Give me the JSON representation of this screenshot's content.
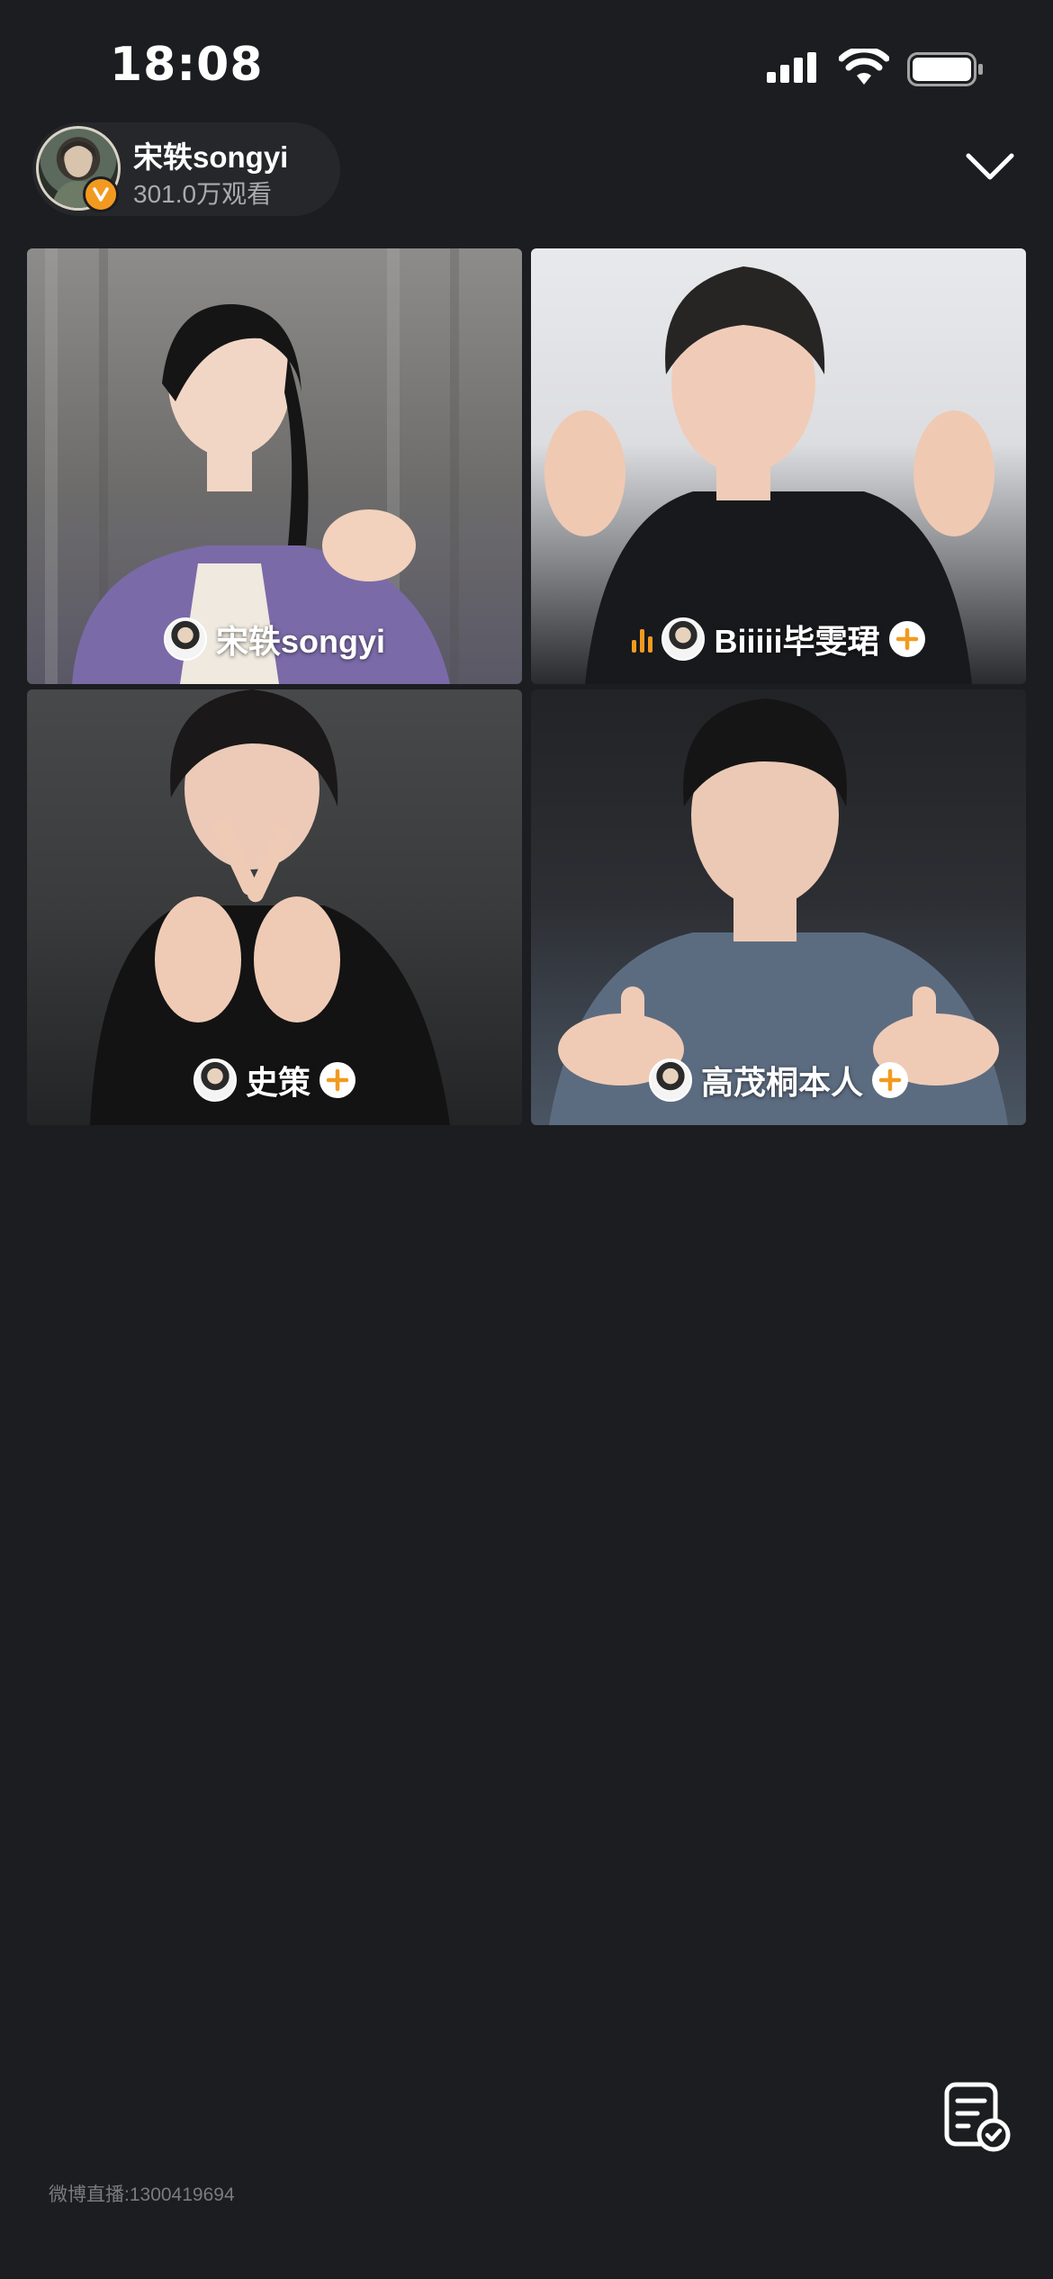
{
  "status_bar": {
    "time": "18:08"
  },
  "header": {
    "host_name": "宋轶songyi",
    "viewer_count": "301.0万观看"
  },
  "tiles": [
    {
      "name": "宋轶songyi",
      "has_follow_button": false,
      "speaking": false
    },
    {
      "name": "Biiiii毕雯珺",
      "has_follow_button": true,
      "speaking": true
    },
    {
      "name": "史策",
      "has_follow_button": true,
      "speaking": false
    },
    {
      "name": "高茂桐本人",
      "has_follow_button": true,
      "speaking": false
    }
  ],
  "footer": {
    "room_id": "微博直播:1300419694"
  },
  "colors": {
    "background": "#1c1d20",
    "accent": "#f29a1f",
    "secondary_text": "#a9aab0"
  },
  "icons": [
    "signal-icon",
    "wifi-icon",
    "battery-icon",
    "verified-icon",
    "chevron-down-icon",
    "plus-icon",
    "speaking-icon",
    "notes-check-icon"
  ]
}
